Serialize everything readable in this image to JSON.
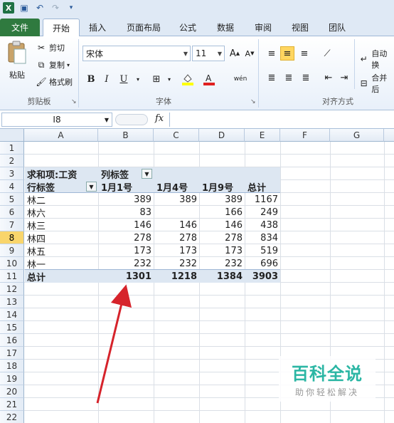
{
  "qat": {
    "undo_icon": "undo-icon",
    "redo_icon": "redo-icon"
  },
  "tabs": [
    {
      "label": "文件"
    },
    {
      "label": "开始"
    },
    {
      "label": "插入"
    },
    {
      "label": "页面布局"
    },
    {
      "label": "公式"
    },
    {
      "label": "数据"
    },
    {
      "label": "审阅"
    },
    {
      "label": "视图"
    },
    {
      "label": "团队"
    }
  ],
  "ribbon": {
    "clipboard": {
      "paste": "粘贴",
      "cut": "剪切",
      "copy": "复制",
      "format_painter": "格式刷",
      "label": "剪贴板"
    },
    "font": {
      "name": "宋体",
      "size": "11",
      "label": "字体",
      "bold": "B",
      "italic": "I",
      "underline": "U"
    },
    "align": {
      "wrap": "自动换",
      "merge": "合并后",
      "label": "对齐方式"
    }
  },
  "formula_bar": {
    "cell_ref": "I8",
    "fx": "fx",
    "content": ""
  },
  "columns": [
    "A",
    "B",
    "C",
    "D",
    "E",
    "F",
    "G"
  ],
  "rows": [
    "1",
    "2",
    "3",
    "4",
    "5",
    "6",
    "7",
    "8",
    "9",
    "10",
    "11",
    "12",
    "13",
    "14",
    "15",
    "16",
    "17",
    "18",
    "19",
    "20",
    "21",
    "22"
  ],
  "selected_row": "8",
  "pivot": {
    "values_label": "求和项:工资",
    "col_labels_label": "列标签",
    "row_labels_label": "行标签",
    "headers": [
      "1月1号",
      "1月4号",
      "1月9号",
      "总计"
    ],
    "rows": [
      {
        "name": "林二",
        "v": [
          "389",
          "389",
          "389",
          "1167"
        ]
      },
      {
        "name": "林六",
        "v": [
          "83",
          "",
          "166",
          "249"
        ]
      },
      {
        "name": "林三",
        "v": [
          "146",
          "146",
          "146",
          "438"
        ]
      },
      {
        "name": "林四",
        "v": [
          "278",
          "278",
          "278",
          "834"
        ]
      },
      {
        "name": "林五",
        "v": [
          "173",
          "173",
          "173",
          "519"
        ]
      },
      {
        "name": "林一",
        "v": [
          "232",
          "232",
          "232",
          "696"
        ]
      }
    ],
    "total": {
      "name": "总计",
      "v": [
        "1301",
        "1218",
        "1384",
        "3903"
      ]
    }
  },
  "watermark": {
    "title": "百科全说",
    "subtitle": "助你轻松解决"
  },
  "colors": {
    "pivot_band": "#dde7f2",
    "file_tab": "#2f7a3f",
    "arrow": "#d6232b",
    "watermark": "#2bb6a4"
  }
}
